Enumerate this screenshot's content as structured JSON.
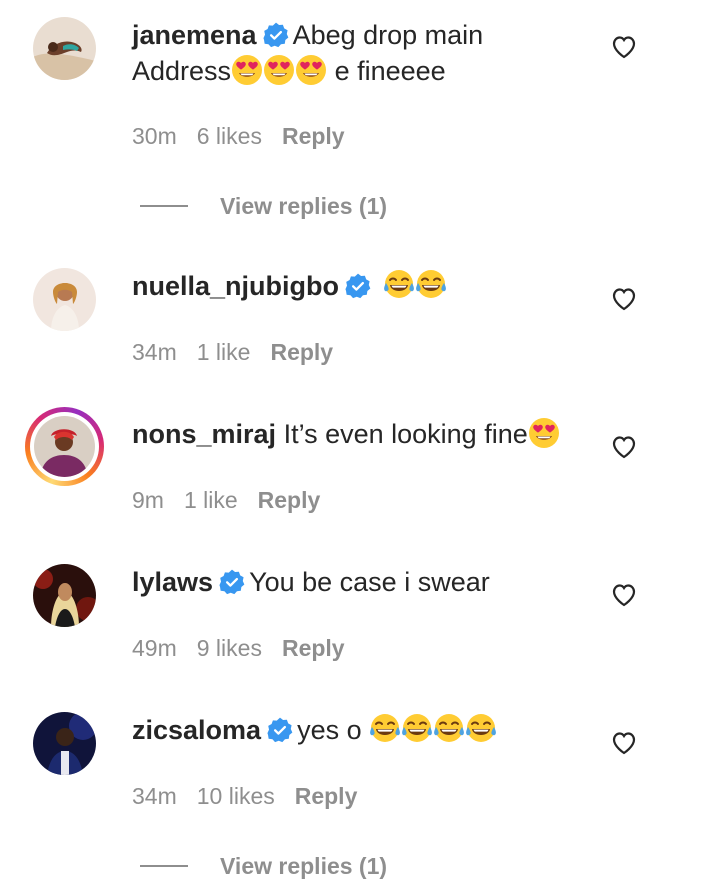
{
  "comments": [
    {
      "username": "janemena",
      "verified": true,
      "text_before": "Abeg drop main Address",
      "emojis": [
        "heart-eyes-emoji",
        "heart-eyes-emoji",
        "heart-eyes-emoji"
      ],
      "text_after": " e fineeee",
      "time": "30m",
      "likes": "6 likes",
      "reply_label": "Reply",
      "view_replies": "View replies (1)"
    },
    {
      "username": "nuella_njubigbo",
      "verified": true,
      "text_before": "",
      "emojis": [
        "tears-of-joy-emoji",
        "tears-of-joy-emoji"
      ],
      "text_after": "",
      "time": "34m",
      "likes": "1 like",
      "reply_label": "Reply"
    },
    {
      "username": "nons_miraj",
      "verified": false,
      "has_story": true,
      "text_before": "It’s even looking fine",
      "emojis": [
        "heart-eyes-emoji"
      ],
      "text_after": "",
      "time": "9m",
      "likes": "1 like",
      "reply_label": "Reply"
    },
    {
      "username": "lylaws",
      "verified": true,
      "text_before": "You be case i swear",
      "emojis": [],
      "text_after": "",
      "time": "49m",
      "likes": "9 likes",
      "reply_label": "Reply"
    },
    {
      "username": "zicsaloma",
      "verified": true,
      "text_before": "yes o ",
      "emojis": [
        "tears-of-joy-emoji",
        "tears-of-joy-emoji",
        "tears-of-joy-emoji",
        "tears-of-joy-emoji"
      ],
      "text_after": "",
      "time": "34m",
      "likes": "10 likes",
      "reply_label": "Reply",
      "view_replies": "View replies (1)"
    }
  ],
  "colors": {
    "text": "#262626",
    "muted": "#8e8e8e",
    "verified_blue": "#3897f0"
  }
}
